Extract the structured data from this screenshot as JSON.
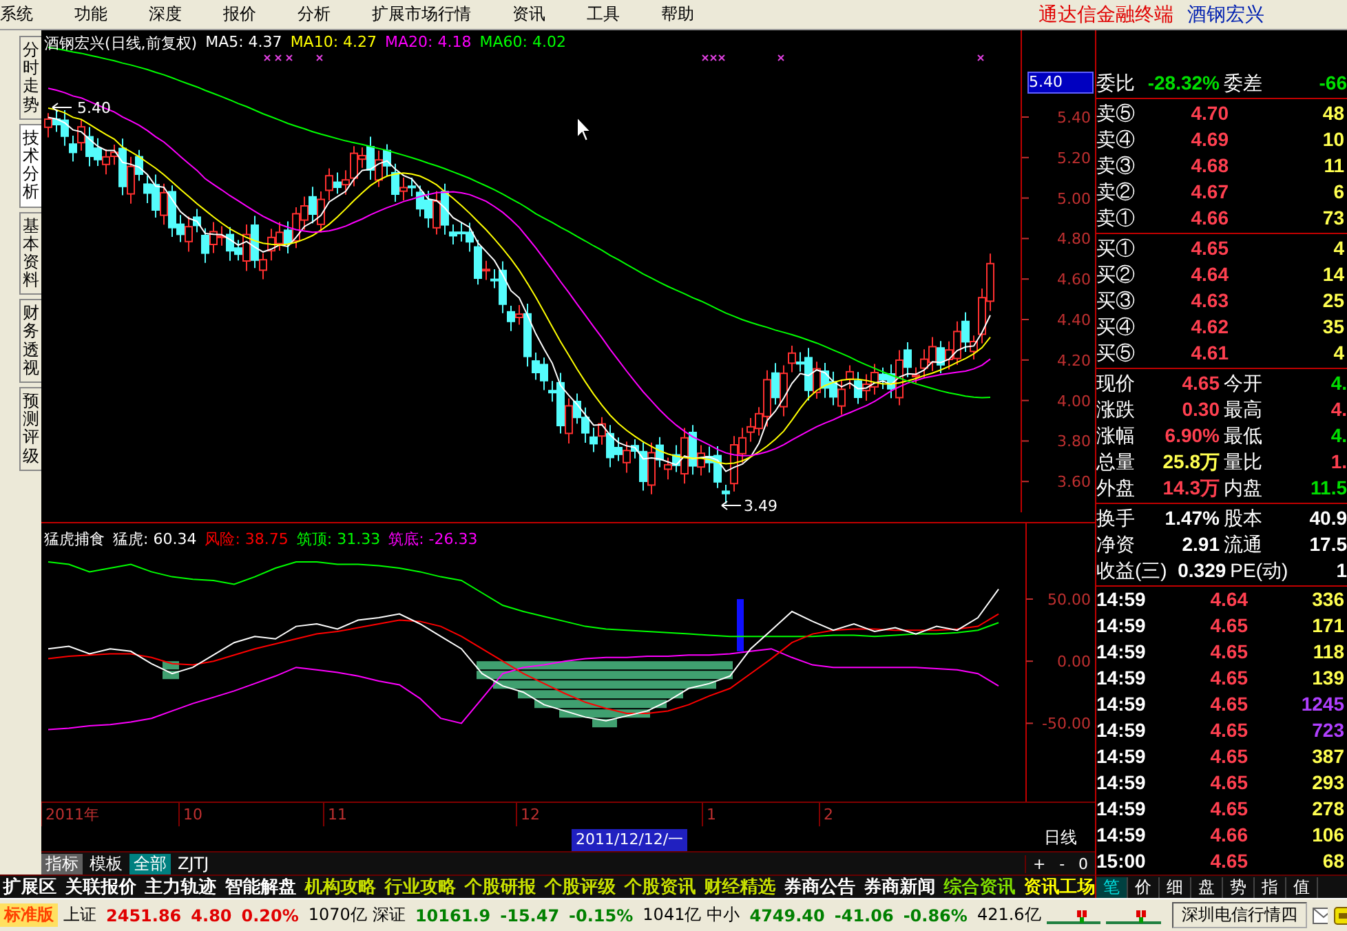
{
  "menu": {
    "items": [
      "系统",
      "功能",
      "深度",
      "报价",
      "分析",
      "扩展市场行情",
      "资讯",
      "工具",
      "帮助"
    ],
    "brand": "通达信金融终端",
    "stock": "酒钢宏兴"
  },
  "side_tabs": [
    {
      "label": "分时走势",
      "selected": false
    },
    {
      "label": "技术分析",
      "selected": true
    },
    {
      "label": "基本资料",
      "selected": false
    },
    {
      "label": "财务透视",
      "selected": false
    },
    {
      "label": "预测评级",
      "selected": false
    }
  ],
  "price_chart": {
    "title": "酒钢宏兴(日线,前复权)",
    "ma": [
      {
        "label": "MA5: 4.37",
        "color": "#ffffff"
      },
      {
        "label": "MA10: 4.27",
        "color": "#ffff00"
      },
      {
        "label": "MA20: 4.18",
        "color": "#ff00ff"
      },
      {
        "label": "MA60: 4.02",
        "color": "#00ff00"
      }
    ],
    "y_labels": [
      "5.40",
      "5.20",
      "5.00",
      "4.80",
      "4.60",
      "4.40",
      "4.20",
      "4.00",
      "3.80",
      "3.60"
    ],
    "cursor_price": "5.40",
    "high_label": "5.40",
    "low_label": "3.49"
  },
  "indicator": {
    "name": "猛虎捕食",
    "readings": [
      ": 60.34",
      ": 38.75",
      ": 31.33",
      ": -26.33"
    ],
    "chart_data": {
      "type": "line",
      "ylim": [
        -113,
        111
      ],
      "yticks": [
        {
          "value": 50,
          "label": "50.00"
        },
        {
          "value": 0,
          "label": "0.00"
        },
        {
          "value": -50,
          "label": "-50.00"
        }
      ],
      "series": [
        {
          "name": "猛虎",
          "color": "#ffffff",
          "values": [
            10,
            12,
            6,
            10,
            8,
            -2,
            -10,
            -5,
            5,
            15,
            20,
            18,
            28,
            30,
            26,
            33,
            35,
            38,
            30,
            20,
            10,
            -10,
            -20,
            -25,
            -35,
            -40,
            -45,
            -48,
            -44,
            -40,
            -32,
            -22,
            -18,
            -12,
            10,
            25,
            40,
            32,
            25,
            30,
            24,
            27,
            22,
            28,
            25,
            35,
            58
          ]
        },
        {
          "name": "风险",
          "color": "#ff0000",
          "values": [
            2,
            4,
            5,
            6,
            6,
            3,
            -2,
            -3,
            0,
            5,
            10,
            14,
            18,
            22,
            24,
            27,
            30,
            33,
            32,
            28,
            20,
            10,
            0,
            -10,
            -18,
            -26,
            -33,
            -38,
            -42,
            -42,
            -40,
            -35,
            -28,
            -22,
            -10,
            2,
            15,
            22,
            25,
            26,
            26,
            25,
            25,
            25,
            26,
            28,
            38
          ]
        },
        {
          "name": "筑顶",
          "color": "#00ff00",
          "values": [
            80,
            78,
            72,
            75,
            78,
            72,
            68,
            66,
            65,
            62,
            68,
            75,
            80,
            80,
            78,
            78,
            77,
            75,
            72,
            68,
            65,
            55,
            45,
            40,
            36,
            32,
            28,
            26,
            25,
            24,
            23,
            22,
            21,
            20,
            20,
            20,
            20,
            20,
            21,
            21,
            20,
            21,
            22,
            22,
            23,
            25,
            31
          ]
        },
        {
          "name": "筑底",
          "color": "#ff00ff",
          "values": [
            -55,
            -54,
            -52,
            -51,
            -49,
            -46,
            -40,
            -34,
            -29,
            -24,
            -18,
            -12,
            -5,
            -7,
            -9,
            -12,
            -16,
            -19,
            -30,
            -46,
            -50,
            -30,
            -10,
            -5,
            -3,
            0,
            2,
            3,
            3,
            4,
            4,
            5,
            5,
            6,
            8,
            10,
            3,
            -3,
            -5,
            -5,
            -5,
            -5,
            -5,
            -6,
            -7,
            -10,
            -20
          ]
        }
      ]
    }
  },
  "date_axis": {
    "labels": [
      "2011年",
      "10",
      "11",
      "12",
      "1",
      "2"
    ],
    "cursor_date": "2011/12/12/一",
    "period": "日线"
  },
  "zoom_buttons": [
    "+",
    "-",
    "0"
  ],
  "chart_tabs": [
    {
      "label": "指标",
      "selected": true,
      "highlighted": false
    },
    {
      "label": "模板",
      "selected": false,
      "highlighted": false
    },
    {
      "label": "全部",
      "selected": false,
      "highlighted": true
    },
    {
      "label": "ZJTJ",
      "selected": false,
      "highlighted": false
    }
  ],
  "info_tabs": [
    {
      "label": "扩展区",
      "kind": "tool"
    },
    {
      "label": "关联报价",
      "kind": "tool"
    },
    {
      "label": "主力轨迹",
      "kind": "tool"
    },
    {
      "label": "智能解盘",
      "kind": "tool"
    },
    {
      "label": "机构攻略",
      "kind": "research"
    },
    {
      "label": "行业攻略",
      "kind": "research"
    },
    {
      "label": "个股研报",
      "kind": "research"
    },
    {
      "label": "个股评级",
      "kind": "research"
    },
    {
      "label": "个股资讯",
      "kind": "research"
    },
    {
      "label": "财经精选",
      "kind": "research"
    },
    {
      "label": "券商公告",
      "kind": "tool"
    },
    {
      "label": "券商新闻",
      "kind": "tool"
    },
    {
      "label": "综合资讯",
      "kind": "summary"
    },
    {
      "label": "资讯工场",
      "kind": "workshop"
    }
  ],
  "quote_tabs": [
    {
      "label": "笔",
      "selected": true
    },
    {
      "label": "价",
      "selected": false
    },
    {
      "label": "细",
      "selected": false
    },
    {
      "label": "盘",
      "selected": false
    },
    {
      "label": "势",
      "selected": false
    },
    {
      "label": "指",
      "selected": false
    },
    {
      "label": "值",
      "selected": false
    }
  ],
  "quote": {
    "ratio": [
      [
        {
          "label": "委比",
          "value": "-28.32%",
          "color": "#00e000"
        },
        {
          "label": "委差",
          "value": "-66",
          "color": "#00e000"
        }
      ]
    ],
    "asks": [
      {
        "label": "卖⑤",
        "price": "4.70",
        "volume": "48"
      },
      {
        "label": "卖④",
        "price": "4.69",
        "volume": "10"
      },
      {
        "label": "卖③",
        "price": "4.68",
        "volume": "11"
      },
      {
        "label": "卖②",
        "price": "4.67",
        "volume": "6"
      },
      {
        "label": "卖①",
        "price": "4.66",
        "volume": "73"
      }
    ],
    "bids": [
      {
        "label": "买①",
        "price": "4.65",
        "volume": "4"
      },
      {
        "label": "买②",
        "price": "4.64",
        "volume": "14"
      },
      {
        "label": "买③",
        "price": "4.63",
        "volume": "25"
      },
      {
        "label": "买④",
        "price": "4.62",
        "volume": "35"
      },
      {
        "label": "买⑤",
        "price": "4.61",
        "volume": "4"
      }
    ],
    "stats": [
      [
        {
          "label": "现价",
          "value": "4.65",
          "color": "#ff4050"
        },
        {
          "label": "今开",
          "value": "4.",
          "color": "#00e000"
        }
      ],
      [
        {
          "label": "涨跌",
          "value": "0.30",
          "color": "#ff4050"
        },
        {
          "label": "最高",
          "value": "4.",
          "color": "#ff4050"
        }
      ],
      [
        {
          "label": "涨幅",
          "value": "6.90%",
          "color": "#ff4050"
        },
        {
          "label": "最低",
          "value": "4.",
          "color": "#00e000"
        }
      ],
      [
        {
          "label": "总量",
          "value": "25.8万",
          "color": "#ffff50"
        },
        {
          "label": "量比",
          "value": "1.",
          "color": "#ff4050"
        }
      ],
      [
        {
          "label": "外盘",
          "value": "14.3万",
          "color": "#ff4050"
        },
        {
          "label": "内盘",
          "value": "11.5",
          "color": "#00e000"
        }
      ]
    ],
    "finance": [
      [
        {
          "label": "换手",
          "value": "1.47%",
          "color": "#ffffff"
        },
        {
          "label": "股本",
          "value": "40.9",
          "color": "#ffffff"
        }
      ],
      [
        {
          "label": "净资",
          "value": "2.91",
          "color": "#ffffff"
        },
        {
          "label": "流通",
          "value": "17.5",
          "color": "#ffffff"
        }
      ],
      [
        {
          "label": "收益(三)",
          "value": "0.329",
          "color": "#ffffff"
        },
        {
          "label": "PE(动)",
          "value": "1",
          "color": "#ffffff"
        }
      ]
    ],
    "ticks": [
      {
        "time": "14:59",
        "price": "4.64",
        "volume": "336",
        "large": false
      },
      {
        "time": "14:59",
        "price": "4.65",
        "volume": "171",
        "large": false
      },
      {
        "time": "14:59",
        "price": "4.65",
        "volume": "118",
        "large": false
      },
      {
        "time": "14:59",
        "price": "4.65",
        "volume": "139",
        "large": false
      },
      {
        "time": "14:59",
        "price": "4.65",
        "volume": "1245",
        "large": true
      },
      {
        "time": "14:59",
        "price": "4.65",
        "volume": "723",
        "large": true
      },
      {
        "time": "14:59",
        "price": "4.65",
        "volume": "387",
        "large": false
      },
      {
        "time": "14:59",
        "price": "4.65",
        "volume": "293",
        "large": false
      },
      {
        "time": "14:59",
        "price": "4.65",
        "volume": "278",
        "large": false
      },
      {
        "time": "14:59",
        "price": "4.66",
        "volume": "106",
        "large": false
      },
      {
        "time": "15:00",
        "price": "4.65",
        "volume": "68",
        "large": false
      }
    ]
  },
  "status_bar": {
    "edition": "标准版",
    "indices": [
      {
        "name": "上证",
        "value": "2451.86",
        "change": "4.80",
        "pct": "0.20%",
        "amount": "1070亿",
        "up": true
      },
      {
        "name": "深证",
        "value": "10161.9",
        "change": "-15.47",
        "pct": "-0.15%",
        "amount": "1041亿",
        "up": false
      },
      {
        "name": "中小",
        "value": "4749.40",
        "change": "-41.06",
        "pct": "-0.86%",
        "amount": "421.6亿",
        "up": false
      }
    ],
    "server": "深圳电信行情四"
  }
}
